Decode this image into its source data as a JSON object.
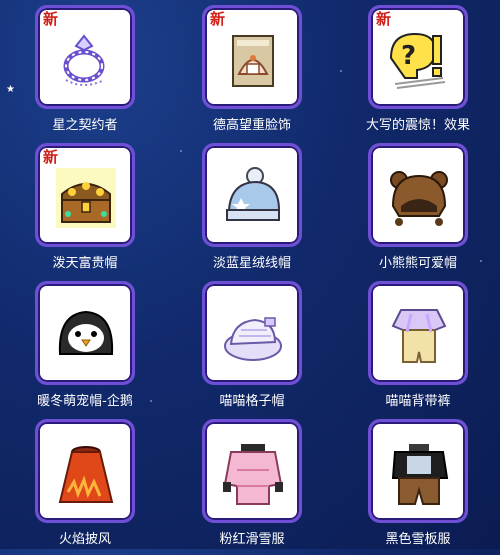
{
  "items": [
    {
      "label": "星之契约者",
      "new": "新",
      "icon": "bracelet-icon"
    },
    {
      "label": "德高望重脸饰",
      "new": "新",
      "icon": "face-accessory-icon"
    },
    {
      "label": "大写的震惊！效果",
      "new": "新",
      "icon": "shock-effect-icon"
    },
    {
      "label": "泼天富贵帽",
      "new": "新",
      "icon": "treasure-chest-hat-icon"
    },
    {
      "label": "淡蓝星绒线帽",
      "new": "",
      "icon": "blue-beanie-icon"
    },
    {
      "label": "小熊熊可爱帽",
      "new": "",
      "icon": "bear-hat-icon"
    },
    {
      "label": "暖冬萌宠帽-企鹅",
      "new": "",
      "icon": "penguin-hat-icon"
    },
    {
      "label": "喵喵格子帽",
      "new": "",
      "icon": "plaid-cap-icon"
    },
    {
      "label": "喵喵背带裤",
      "new": "",
      "icon": "overalls-icon"
    },
    {
      "label": "火焰披风",
      "new": "",
      "icon": "flame-cape-icon"
    },
    {
      "label": "粉红滑雪服",
      "new": "",
      "icon": "pink-ski-suit-icon"
    },
    {
      "label": "黑色雪板服",
      "new": "",
      "icon": "black-snowboard-suit-icon"
    }
  ],
  "colors": {
    "card_border": "#6e4fd6",
    "label": "#ffffff",
    "new_badge": "#d0201a",
    "background": "#11296b"
  }
}
